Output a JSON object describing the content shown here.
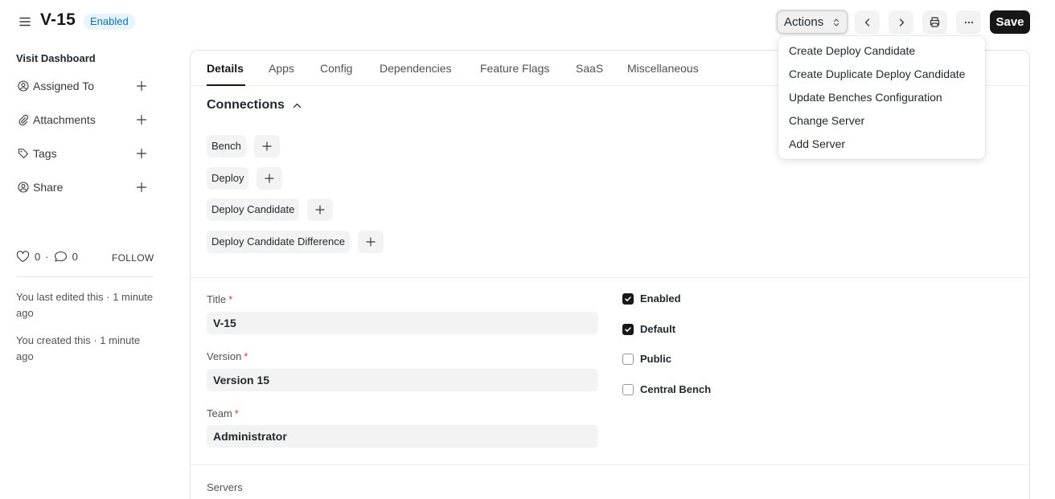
{
  "header": {
    "title": "V-15",
    "status": "Enabled",
    "actions_label": "Actions",
    "save_label": "Save"
  },
  "actions_menu": {
    "items": [
      "Create Deploy Candidate",
      "Create Duplicate Deploy Candidate",
      "Update Benches Configuration",
      "Change Server",
      "Add Server"
    ]
  },
  "sidebar": {
    "dashboard_link": "Visit Dashboard",
    "items": [
      {
        "label": "Assigned To",
        "icon": "assign-user-icon"
      },
      {
        "label": "Attachments",
        "icon": "paperclip-icon"
      },
      {
        "label": "Tags",
        "icon": "tag-icon"
      },
      {
        "label": "Share",
        "icon": "share-user-icon"
      }
    ],
    "likes": "0",
    "comments": "0",
    "follow_label": "FOLLOW",
    "activity": [
      "You last edited this · 1 minute ago",
      "You created this · 1 minute ago"
    ]
  },
  "tabs": [
    "Details",
    "Apps",
    "Config",
    "Dependencies",
    "Feature Flags",
    "SaaS",
    "Miscellaneous"
  ],
  "connections": {
    "title": "Connections",
    "items": [
      "Bench",
      "Deploy",
      "Deploy Candidate",
      "Deploy Candidate Difference"
    ]
  },
  "fields": {
    "title": {
      "label": "Title",
      "value": "V-15"
    },
    "version": {
      "label": "Version",
      "value": "Version 15"
    },
    "team": {
      "label": "Team",
      "value": "Administrator"
    },
    "required_mark": "*"
  },
  "checks": [
    {
      "label": "Enabled",
      "checked": true
    },
    {
      "label": "Default",
      "checked": true
    },
    {
      "label": "Public",
      "checked": false
    },
    {
      "label": "Central Bench",
      "checked": false
    }
  ],
  "servers_label": "Servers",
  "colors": {
    "accent": "#171717",
    "badge_bg": "#e6f4ff",
    "badge_text": "#0b72c3",
    "required": "#e03636"
  }
}
